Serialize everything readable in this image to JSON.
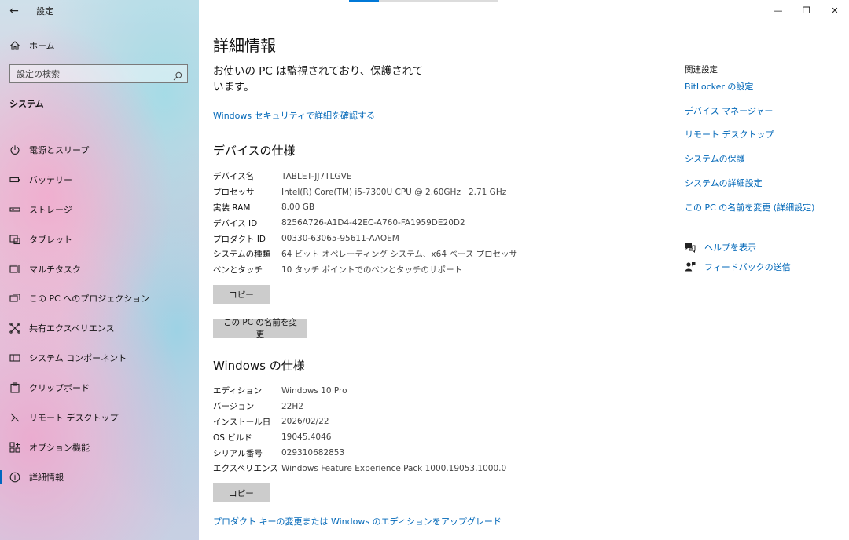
{
  "window": {
    "app_title": "設定",
    "controls": {
      "minimize": "—",
      "maximize": "❐",
      "close": "✕"
    }
  },
  "sidebar": {
    "home_label": "ホーム",
    "search_placeholder": "設定の検索",
    "section_title": "システム",
    "items": [
      {
        "label": "電源とスリープ",
        "icon": "power-icon"
      },
      {
        "label": "バッテリー",
        "icon": "battery-icon"
      },
      {
        "label": "ストレージ",
        "icon": "storage-icon"
      },
      {
        "label": "タブレット",
        "icon": "tablet-icon"
      },
      {
        "label": "マルチタスク",
        "icon": "multitask-icon"
      },
      {
        "label": "この PC へのプロジェクション",
        "icon": "projection-icon"
      },
      {
        "label": "共有エクスペリエンス",
        "icon": "shared-experience-icon"
      },
      {
        "label": "システム コンポーネント",
        "icon": "system-components-icon"
      },
      {
        "label": "クリップボード",
        "icon": "clipboard-icon"
      },
      {
        "label": "リモート デスクトップ",
        "icon": "remote-desktop-icon"
      },
      {
        "label": "オプション機能",
        "icon": "optional-features-icon"
      },
      {
        "label": "詳細情報",
        "icon": "info-icon",
        "active": true
      }
    ]
  },
  "main": {
    "title": "詳細情報",
    "headline": "お使いの PC は監視されており、保護されています。",
    "security_link": "Windows セキュリティで詳細を確認する",
    "device_spec": {
      "heading": "デバイスの仕様",
      "rows": [
        {
          "key": "デバイス名",
          "value": "TABLET-JJ7TLGVE"
        },
        {
          "key": "プロセッサ",
          "value": "Intel(R) Core(TM) i5-7300U CPU @ 2.60GHz   2.71 GHz"
        },
        {
          "key": "実装 RAM",
          "value": "8.00 GB"
        },
        {
          "key": "デバイス ID",
          "value": "8256A726-A1D4-42EC-A760-FA1959DE20D2"
        },
        {
          "key": "プロダクト ID",
          "value": "00330-63065-95611-AAOEM"
        },
        {
          "key": "システムの種類",
          "value": "64 ビット オペレーティング システム、x64 ベース プロセッサ"
        },
        {
          "key": "ペンとタッチ",
          "value": "10 タッチ ポイントでのペンとタッチのサポート"
        }
      ],
      "copy_label": "コピー",
      "rename_label": "この PC の名前を変更"
    },
    "windows_spec": {
      "heading": "Windows の仕様",
      "rows": [
        {
          "key": "エディション",
          "value": "Windows 10 Pro"
        },
        {
          "key": "バージョン",
          "value": "22H2"
        },
        {
          "key": "インストール日",
          "value": "2026/02/22"
        },
        {
          "key": "OS ビルド",
          "value": "19045.4046"
        },
        {
          "key": "シリアル番号",
          "value": "029310682853"
        },
        {
          "key": "エクスペリエンス",
          "value": "Windows Feature Experience Pack 1000.19053.1000.0"
        }
      ],
      "copy_label": "コピー"
    },
    "upgrade_link": "プロダクト キーの変更または Windows のエディションをアップグレード"
  },
  "related": {
    "title": "関連設定",
    "links": [
      "BitLocker の設定",
      "デバイス マネージャー",
      "リモート デスクトップ",
      "システムの保護",
      "システムの詳細設定",
      "この PC の名前を変更 (詳細設定)"
    ],
    "help": {
      "label": "ヘルプを表示",
      "icon": "help-chat-icon"
    },
    "feedback": {
      "label": "フィードバックの送信",
      "icon": "feedback-icon"
    }
  },
  "colors": {
    "link": "#0067b8",
    "accent": "#0078d7",
    "button_bg": "#cccccc"
  }
}
